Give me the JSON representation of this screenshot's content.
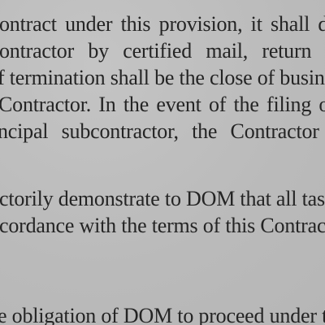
{
  "document": {
    "paragraph_1": [
      "ontract under this provision, it shall do",
      "ontractor by certified mail, return rece",
      "f termination shall be the close of busin",
      "Contractor.  In the event of the filing o",
      "ncipal subcontractor, the Contractor sh"
    ],
    "paragraph_2": [
      "ctorily demonstrate to DOM that all tas",
      "cordance with the terms of this Contract"
    ],
    "paragraph_3": [
      "e obligation of DOM to proceed under t"
    ]
  }
}
